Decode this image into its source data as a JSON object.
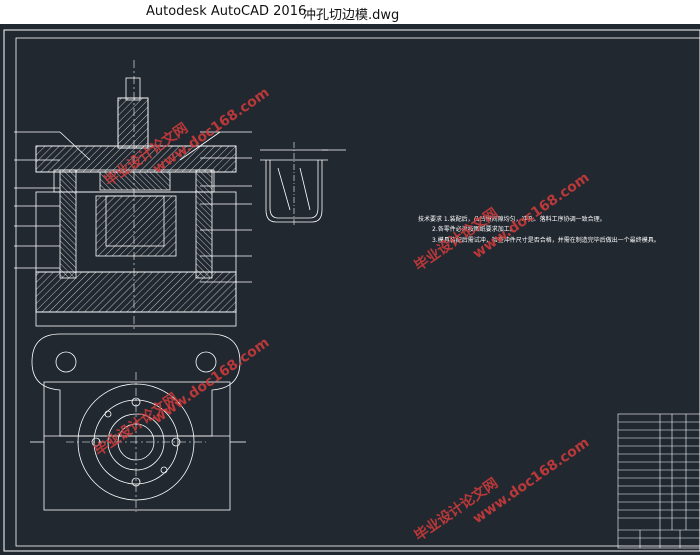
{
  "window": {
    "app_title": "Autodesk AutoCAD 2016",
    "file_title": "冲孔切边模.dwg"
  },
  "drawing": {
    "notes": [
      "技术要求 1.装配后，凸凹模间隙均匀，冲孔、落料工序协调一致合理。",
      "2.各零件必须按图纸要求加工。",
      "3.模具装配后需试冲，检查冲件尺寸是否合格，并需在制造完毕后做出一个最终模具。"
    ]
  },
  "watermarks": [
    "www.doc168.com",
    "毕业设计论文网"
  ],
  "colors": {
    "background": "#212830",
    "lines": "#ffffff",
    "watermark": "#d43b3b"
  }
}
